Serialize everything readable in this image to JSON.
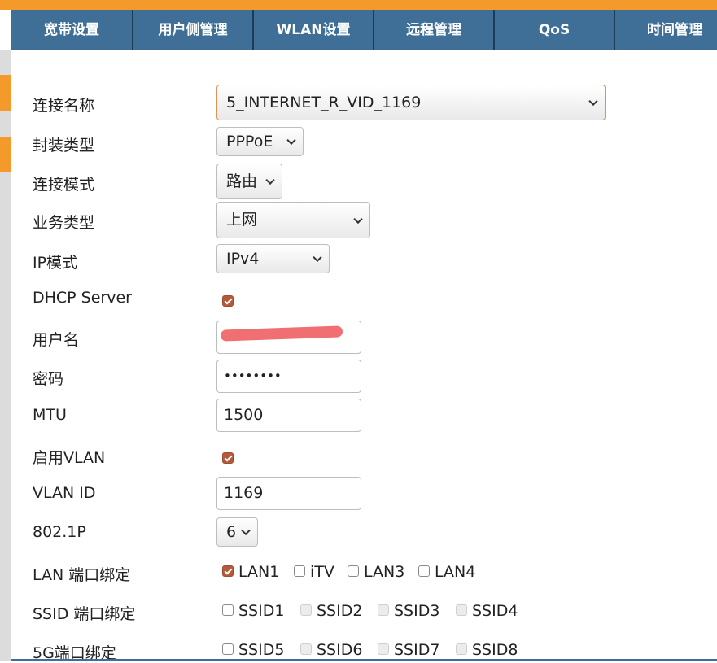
{
  "nav": {
    "tabs": [
      {
        "label": "宽带设置"
      },
      {
        "label": "用户侧管理"
      },
      {
        "label": "WLAN设置"
      },
      {
        "label": "远程管理"
      },
      {
        "label": "QoS"
      },
      {
        "label": "时间管理"
      }
    ]
  },
  "form": {
    "connection_name": {
      "label": "连接名称",
      "value": "5_INTERNET_R_VID_1169"
    },
    "encapsulation": {
      "label": "封装类型",
      "value": "PPPoE"
    },
    "connection_mode": {
      "label": "连接模式",
      "value": "路由"
    },
    "service_type": {
      "label": "业务类型",
      "value": "上网"
    },
    "ip_mode": {
      "label": "IP模式",
      "value": "IPv4"
    },
    "dhcp_server": {
      "label": "DHCP Server",
      "checked": true
    },
    "username": {
      "label": "用户名",
      "value": ""
    },
    "password": {
      "label": "密码",
      "value": "••••••••"
    },
    "mtu": {
      "label": "MTU",
      "value": "1500"
    },
    "enable_vlan": {
      "label": "启用VLAN",
      "checked": true
    },
    "vlan_id": {
      "label": "VLAN ID",
      "value": "1169"
    },
    "dot1p": {
      "label": "802.1P",
      "value": "6"
    },
    "lan_binding": {
      "label": "LAN 端口绑定",
      "options": [
        {
          "name": "LAN1",
          "checked": true
        },
        {
          "name": "iTV",
          "checked": false
        },
        {
          "name": "LAN3",
          "checked": false
        },
        {
          "name": "LAN4",
          "checked": false
        }
      ]
    },
    "ssid_binding": {
      "label": "SSID 端口绑定",
      "options": [
        {
          "name": "SSID1",
          "checked": false,
          "disabled": false
        },
        {
          "name": "SSID2",
          "checked": false,
          "disabled": true
        },
        {
          "name": "SSID3",
          "checked": false,
          "disabled": true
        },
        {
          "name": "SSID4",
          "checked": false,
          "disabled": true
        }
      ]
    },
    "ssid5g_binding": {
      "label": "5G端口绑定",
      "options": [
        {
          "name": "SSID5",
          "checked": false,
          "disabled": false
        },
        {
          "name": "SSID6",
          "checked": false,
          "disabled": true
        },
        {
          "name": "SSID7",
          "checked": false,
          "disabled": true
        },
        {
          "name": "SSID8",
          "checked": false,
          "disabled": true
        }
      ]
    }
  },
  "colors": {
    "accent_orange": "#f39a2a",
    "nav_blue": "#3f6f97",
    "checkbox_checked": "#b35a3a"
  }
}
